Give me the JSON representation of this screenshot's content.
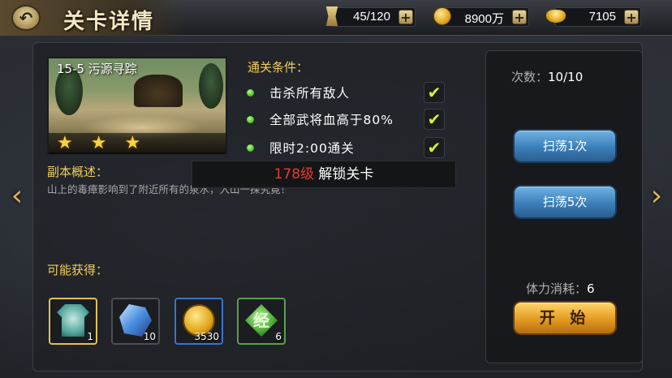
{
  "header": {
    "title": "关卡详情",
    "back_icon": "back-arrow-icon"
  },
  "resources": {
    "stamina": {
      "value": "45/120",
      "icon": "scroll-icon"
    },
    "coins": {
      "value": "8900万",
      "icon": "coin-icon"
    },
    "ingots": {
      "value": "7105",
      "icon": "ingot-icon"
    }
  },
  "stage": {
    "name": "15-5 污源寻踪",
    "stars": 3
  },
  "conditions": {
    "title": "通关条件：",
    "items": [
      {
        "label": "击杀所有敌人",
        "done": true
      },
      {
        "label": "全部武将血高于80%",
        "done": true
      },
      {
        "label": "限时2:00通关",
        "done": true
      }
    ]
  },
  "lock": {
    "level": "178级",
    "text": "解锁关卡"
  },
  "description": {
    "title": "副本概述：",
    "text": "山上的毒瘴影响到了附近所有的泉水，入山一探究竟！"
  },
  "rewards": {
    "title": "可能获得：",
    "items": [
      {
        "icon": "armor-fragment-icon",
        "count": "1",
        "frame": "yellow"
      },
      {
        "icon": "crystal-icon",
        "count": "10",
        "frame": "gray"
      },
      {
        "icon": "gold-coin-icon",
        "count": "3530",
        "frame": "blue"
      },
      {
        "icon": "scripture-icon",
        "count": "6",
        "frame": "green",
        "glyph": "经"
      }
    ]
  },
  "side": {
    "count_label": "次数：",
    "count_value": "10/10",
    "sweep_once": "扫荡1次",
    "sweep_five": "扫荡5次",
    "stamina_label": "体力消耗：",
    "stamina_value": "6",
    "start": "开 始"
  },
  "colors": {
    "accent_gold": "#f2cf5a",
    "lock_level_red": "#e63b2e",
    "check_yellow": "#d9ef3b",
    "button_blue": "#3b7fb9",
    "button_orange": "#e39a22"
  }
}
